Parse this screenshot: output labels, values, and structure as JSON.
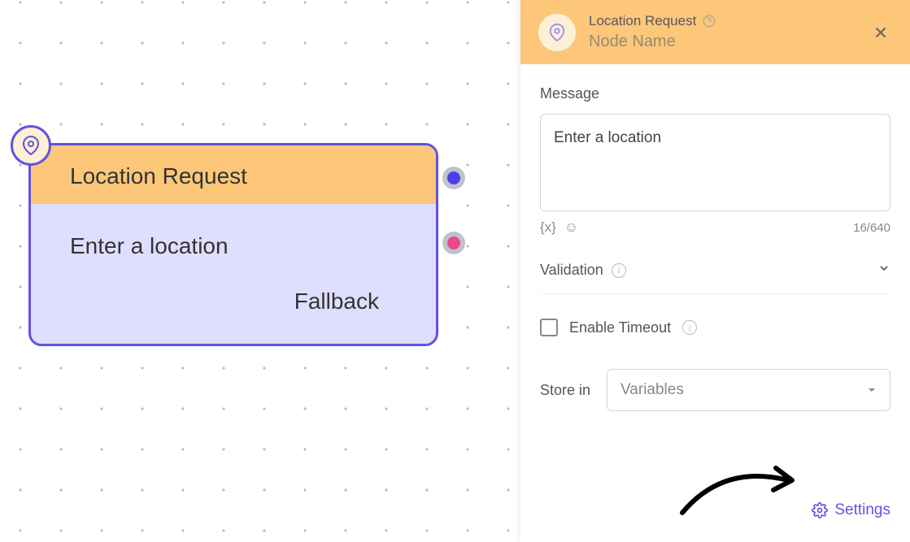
{
  "node": {
    "title": "Location Request",
    "message": "Enter a location",
    "fallback_label": "Fallback"
  },
  "panel": {
    "title": "Location Request",
    "subtitle": "Node Name",
    "message_label": "Message",
    "message_value": "Enter a location",
    "char_count": "16/640",
    "validation_label": "Validation",
    "timeout_label": "Enable Timeout",
    "store_label": "Store in",
    "store_placeholder": "Variables",
    "settings_label": "Settings"
  }
}
